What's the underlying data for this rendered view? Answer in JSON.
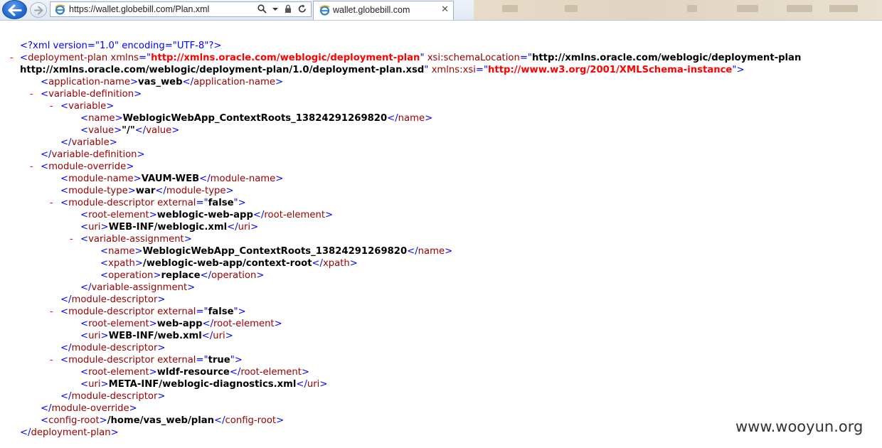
{
  "browser": {
    "address_url": "https://wallet.globebill.com/Plan.xml",
    "tab_title": "wallet.globebill.com",
    "tab_close": "✕",
    "icons": [
      "back-arrow-icon",
      "forward-arrow-icon",
      "ie-logo-icon",
      "search-icon",
      "dropdown-icon",
      "lock-icon",
      "refresh-icon",
      "close-icon"
    ],
    "accent_color": "#1f63c9"
  },
  "xml": {
    "prolog": "<?xml version=\"1.0\" encoding=\"UTF-8\"?>",
    "toggle": "-",
    "root": {
      "name": "deployment-plan",
      "attrs": [
        {
          "name": "xmlns",
          "value": "http://xmlns.oracle.com/weblogic/deployment-plan"
        },
        {
          "name": "xsi:schemaLocation",
          "value": "http://xmlns.oracle.com/weblogic/deployment-plan http://xmlns.oracle.com/weblogic/deployment-plan/1.0/deployment-plan.xsd"
        },
        {
          "name": "xmlns:xsi",
          "value": "http://www.w3.org/2001/XMLSchema-instance"
        }
      ],
      "schema_value_line1": "http://xmlns.oracle.com/weblogic/deployment-plan",
      "schema_value_line2": "http://xmlns.oracle.com/weblogic/deployment-plan/1.0/deployment-plan.xsd"
    },
    "application_name": {
      "tag": "application-name",
      "value": "vas_web"
    },
    "variable_definition": {
      "tag": "variable-definition",
      "variable": {
        "tag": "variable",
        "name": {
          "tag": "name",
          "value": "WeblogicWebApp_ContextRoots_13824291269820"
        },
        "value": {
          "tag": "value",
          "value": "\"/\""
        }
      }
    },
    "module_override": {
      "tag": "module-override",
      "module_name": {
        "tag": "module-name",
        "value": "VAUM-WEB"
      },
      "module_type": {
        "tag": "module-type",
        "value": "war"
      },
      "descriptors": [
        {
          "tag": "module-descriptor",
          "attr_name": "external",
          "attr_value": "false",
          "root_element": {
            "tag": "root-element",
            "value": "weblogic-web-app"
          },
          "uri": {
            "tag": "uri",
            "value": "WEB-INF/weblogic.xml"
          },
          "variable_assignment": {
            "tag": "variable-assignment",
            "name": {
              "tag": "name",
              "value": "WeblogicWebApp_ContextRoots_13824291269820"
            },
            "xpath": {
              "tag": "xpath",
              "value": "/weblogic-web-app/context-root"
            },
            "operation": {
              "tag": "operation",
              "value": "replace"
            }
          }
        },
        {
          "tag": "module-descriptor",
          "attr_name": "external",
          "attr_value": "false",
          "root_element": {
            "tag": "root-element",
            "value": "web-app"
          },
          "uri": {
            "tag": "uri",
            "value": "WEB-INF/web.xml"
          }
        },
        {
          "tag": "module-descriptor",
          "attr_name": "external",
          "attr_value": "true",
          "root_element": {
            "tag": "root-element",
            "value": "wldf-resource"
          },
          "uri": {
            "tag": "uri",
            "value": "META-INF/weblogic-diagnostics.xml"
          }
        }
      ]
    },
    "config_root": {
      "tag": "config-root",
      "value": "/home/vas_web/plan"
    }
  },
  "watermark": "www.wooyun.org"
}
